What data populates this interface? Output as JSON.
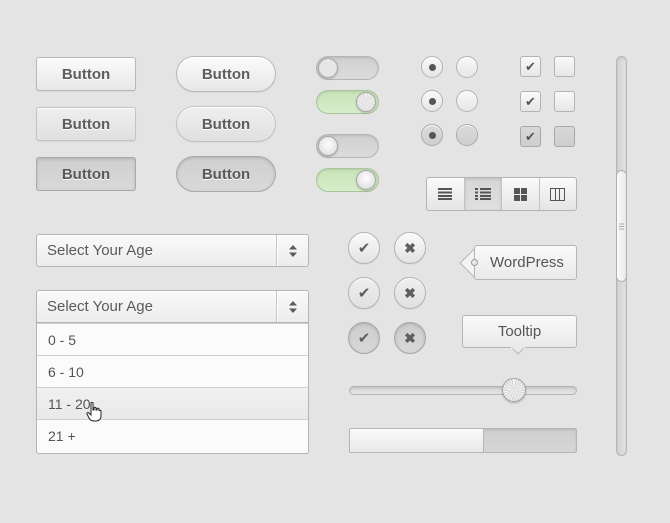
{
  "buttons": {
    "square": [
      "Button",
      "Button",
      "Button"
    ],
    "pill": [
      "Button",
      "Button",
      "Button"
    ]
  },
  "toggles": [
    {
      "state": "off",
      "knob": "metal"
    },
    {
      "state": "on",
      "knob": "metal"
    },
    {
      "state": "off",
      "knob": "plain"
    },
    {
      "state": "on",
      "knob": "plain"
    }
  ],
  "radios": {
    "rows": 3,
    "selected_column": 0
  },
  "checkboxes": {
    "rows": 3,
    "checked_column": 0
  },
  "view_toggle": {
    "icons": [
      "list-icon",
      "detailed-list-icon",
      "grid-icon",
      "columns-icon"
    ],
    "selected_index": 1
  },
  "select_closed": {
    "placeholder": "Select Your Age"
  },
  "select_open": {
    "placeholder": "Select Your Age",
    "options": [
      "0 - 5",
      "6 - 10",
      "11 - 20",
      "21 +"
    ],
    "hovered_index": 2
  },
  "action_buttons": {
    "confirm_icon": "check-icon",
    "cancel_icon": "x-icon",
    "states": [
      "normal",
      "hover",
      "active"
    ]
  },
  "tag": {
    "label": "WordPress"
  },
  "tooltip": {
    "label": "Tooltip"
  },
  "slider": {
    "value": 0.75
  },
  "progress": {
    "value": 0.6
  },
  "scrollbar": {
    "position": 0.25
  },
  "colors": {
    "background": "#e4e4e4",
    "toggle_on": "#cfe8bf",
    "text": "#5a5a5a"
  }
}
